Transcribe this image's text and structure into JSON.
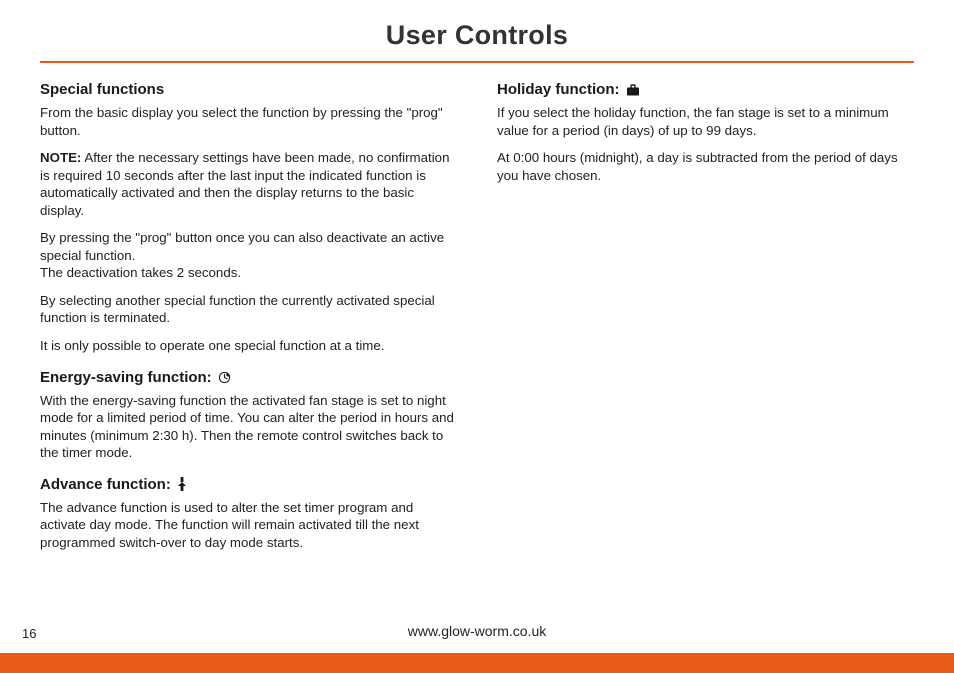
{
  "title": "User Controls",
  "footer_url": "www.glow-worm.co.uk",
  "page_number": "16",
  "left": {
    "special_functions": {
      "heading": "Special functions",
      "p1": "From the basic display you select the function by pressing the \"prog\" button.",
      "note_label": "NOTE:",
      "note_body": " After the necessary settings have been made, no confirmation is required 10 seconds after the last input the indicated function is automatically activated and then the display returns to the basic display.",
      "p3a": "By pressing the \"prog\" button once you can also deactivate an active special function.",
      "p3b": "The deactivation takes 2 seconds.",
      "p4": "By selecting another special function the currently activated special function is terminated.",
      "p5": "It is only possible to operate one special function at a time."
    },
    "energy_saving": {
      "heading": "Energy-saving function:",
      "icon": "moon-clock-icon",
      "p1": "With the energy-saving function the activated fan stage is set to night mode for a limited period of time. You can alter the period in hours and minutes (minimum 2:30 h). Then the remote control switches back to the timer mode."
    },
    "advance": {
      "heading": "Advance function:",
      "icon": "advance-icon",
      "p1": "The advance function is used to alter the set timer program and activate day mode. The function will remain activated till the next programmed switch-over to day mode starts."
    }
  },
  "right": {
    "holiday": {
      "heading": "Holiday function:",
      "icon": "suitcase-icon",
      "p1": "If you select the holiday function, the fan stage is set to a minimum value for a period (in days) of up to 99 days.",
      "p2": "At 0:00 hours (midnight), a day is subtracted from the period of days you have chosen."
    }
  }
}
